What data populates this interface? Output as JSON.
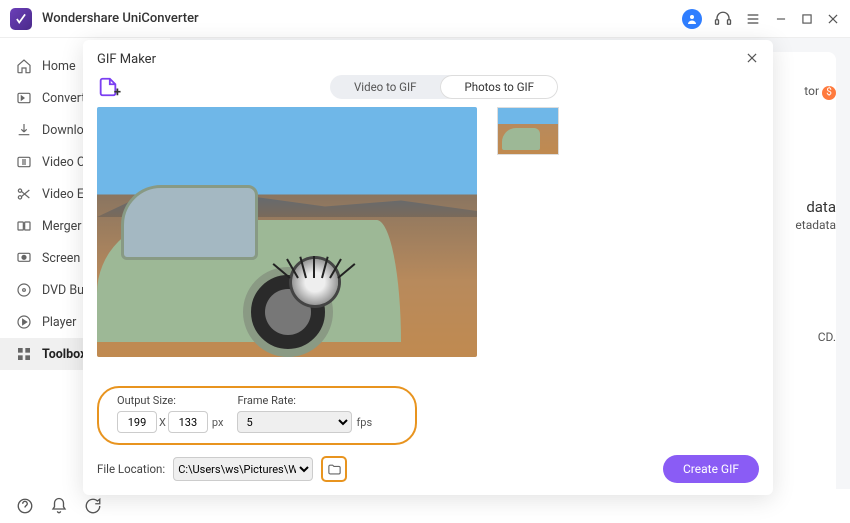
{
  "titlebar": {
    "app_name": "Wondershare UniConverter"
  },
  "sidebar": {
    "items": [
      {
        "label": "Home",
        "icon": "home-icon"
      },
      {
        "label": "Converter",
        "icon": "converter-icon"
      },
      {
        "label": "Downloader",
        "icon": "download-icon"
      },
      {
        "label": "Video Compressor",
        "icon": "compress-icon"
      },
      {
        "label": "Video Editor",
        "icon": "scissors-icon"
      },
      {
        "label": "Merger",
        "icon": "merge-icon"
      },
      {
        "label": "Screen Recorder",
        "icon": "record-icon"
      },
      {
        "label": "DVD Burner",
        "icon": "dvd-icon"
      },
      {
        "label": "Player",
        "icon": "play-icon"
      },
      {
        "label": "Toolbox",
        "icon": "grid-icon"
      }
    ],
    "active_index": 9
  },
  "background_fragments": {
    "f1": "tor",
    "f2": "data",
    "f3": "etadata",
    "f4": "CD."
  },
  "modal": {
    "title": "GIF Maker",
    "tabs": {
      "video": "Video to GIF",
      "photos": "Photos to GIF",
      "active": "photos"
    },
    "output": {
      "size_label": "Output Size:",
      "width": "199",
      "height": "133",
      "size_sep": "X",
      "size_unit": "px",
      "frame_label": "Frame Rate:",
      "frame_value": "5",
      "frame_unit": "fps"
    },
    "footer": {
      "location_label": "File Location:",
      "location_value": "C:\\Users\\ws\\Pictures\\Wondershare",
      "create_label": "Create GIF"
    }
  }
}
